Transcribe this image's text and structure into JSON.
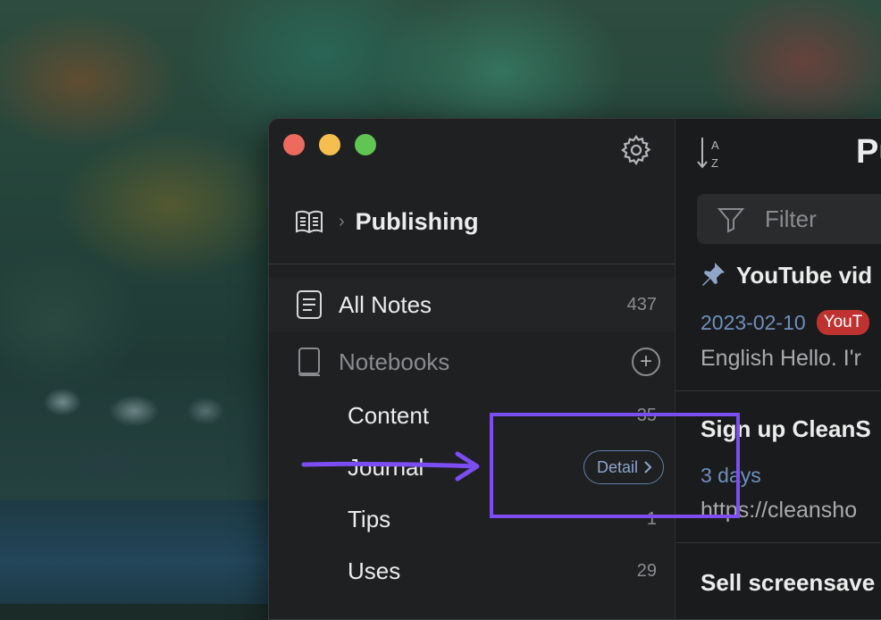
{
  "sidebar": {
    "breadcrumb": {
      "title": "Publishing"
    },
    "all_notes": {
      "label": "All Notes",
      "count": "437"
    },
    "notebooks": {
      "label": "Notebooks"
    },
    "items": [
      {
        "label": "Content",
        "count": "35"
      },
      {
        "label": "Journal",
        "detail_label": "Detail"
      },
      {
        "label": "Tips",
        "count": "1"
      },
      {
        "label": "Uses",
        "count": "29"
      }
    ]
  },
  "list": {
    "title": "Pu",
    "filter_placeholder": "Filter",
    "notes": [
      {
        "title": "YouTube vid",
        "date": "2023-02-10",
        "tag": "YouT",
        "body": "English Hello. I'r"
      },
      {
        "title": "Sign up CleanS",
        "date": "3 days",
        "body": "https://cleansho"
      },
      {
        "title": "Sell screensave"
      }
    ]
  },
  "colors": {
    "accent_annotation": "#7b4df2",
    "tag_red": "#c0322f",
    "date_blue": "#6f8fbd"
  },
  "icons": {
    "gear": "gear-icon",
    "book": "open-book-icon",
    "note": "document-icon",
    "notebook": "notebook-icon",
    "sort": "sort-az-icon",
    "filter": "filter-funnel-icon",
    "pin": "pushpin-icon"
  }
}
